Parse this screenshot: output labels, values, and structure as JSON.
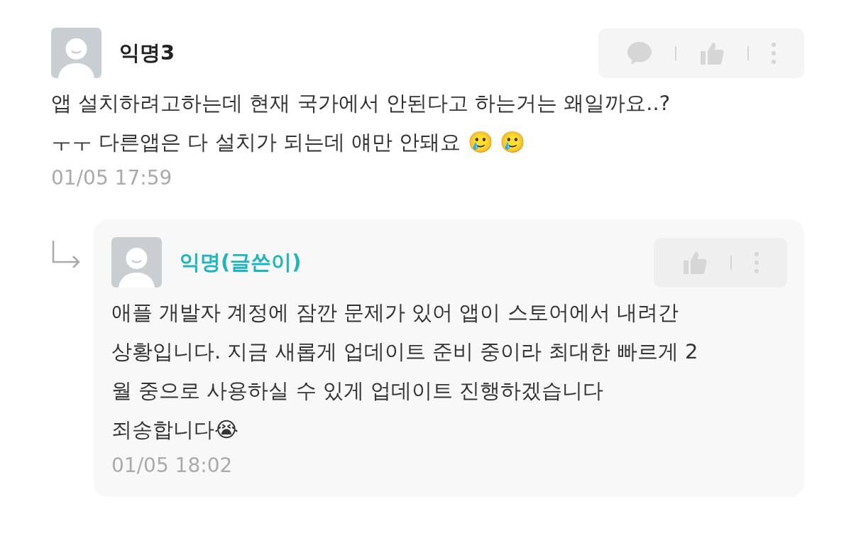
{
  "comments": [
    {
      "author": "익명3",
      "is_author": false,
      "actions": [
        {
          "kind": "comment"
        },
        {
          "kind": "like"
        },
        {
          "kind": "more"
        }
      ],
      "body": "앱 설치하려고하는데 현재 국가에서 안된다고 하는거는 왜일까요..?\nㅜㅜ 다른앱은 다 설치가 되는데 얘만 안돼요 🥲 🥲",
      "time": "01/05 17:59",
      "replies": [
        {
          "author": "익명(글쓴이)",
          "is_author": true,
          "actions": [
            {
              "kind": "like"
            },
            {
              "kind": "more"
            }
          ],
          "body": "애플 개발자 계정에 잠깐 문제가 있어 앱이 스토어에서 내려간\n상황입니다. 지금 새롭게 업데이트 준비 중이라 최대한 빠르게 2\n월 중으로 사용하실 수 있게 업데이트 진행하겠습니다\n죄송합니다😭",
          "time": "01/05 18:02"
        }
      ]
    }
  ]
}
